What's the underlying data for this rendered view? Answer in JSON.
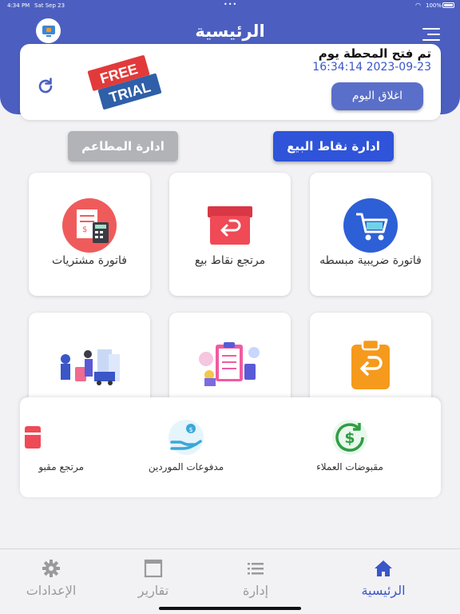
{
  "status_bar": {
    "time": "4:34 PM",
    "date": "Sat Sep 23",
    "battery": "100%"
  },
  "header": {
    "title": "الرئيسية"
  },
  "card": {
    "open_text": "تم فتح المحطة يوم",
    "timestamp": "16:34:14 2023-09-23",
    "close_day_label": "اغلاق اليوم",
    "trial_line1": "FREE",
    "trial_line2": "TRIAL"
  },
  "segments": {
    "pos_label": "ادارة نقاط البيع",
    "restaurants_label": "ادارة المطاعم"
  },
  "tiles": [
    {
      "label": "فاتورة ضريبية مبسطه",
      "icon": "cart-icon"
    },
    {
      "label": "مرتجع نقاط بيع",
      "icon": "return-box-icon"
    },
    {
      "label": "فاتورة مشتريات",
      "icon": "receipt-calculator-icon"
    },
    {
      "label": "",
      "icon": "clipboard-return-icon"
    },
    {
      "label": "",
      "icon": "clipboard-report-icon"
    },
    {
      "label": "",
      "icon": "delivery-people-icon"
    }
  ],
  "sheet": {
    "items": [
      {
        "label": "مقبوضات العملاء",
        "icon": "dollar-cycle-icon"
      },
      {
        "label": "مدفوعات الموردين",
        "icon": "hand-coin-icon"
      },
      {
        "label": "مرتجع مقبو",
        "icon": "red-partial-icon"
      }
    ]
  },
  "tabs": [
    {
      "label": "الرئيسية",
      "icon": "home-icon",
      "active": true
    },
    {
      "label": "إدارة",
      "icon": "list-icon",
      "active": false
    },
    {
      "label": "تقارير",
      "icon": "window-icon",
      "active": false
    },
    {
      "label": "الإعدادات",
      "icon": "gear-icon",
      "active": false
    }
  ],
  "colors": {
    "primary": "#4c5fc0",
    "accent": "#2f54d9",
    "background": "#f2f2f5"
  }
}
